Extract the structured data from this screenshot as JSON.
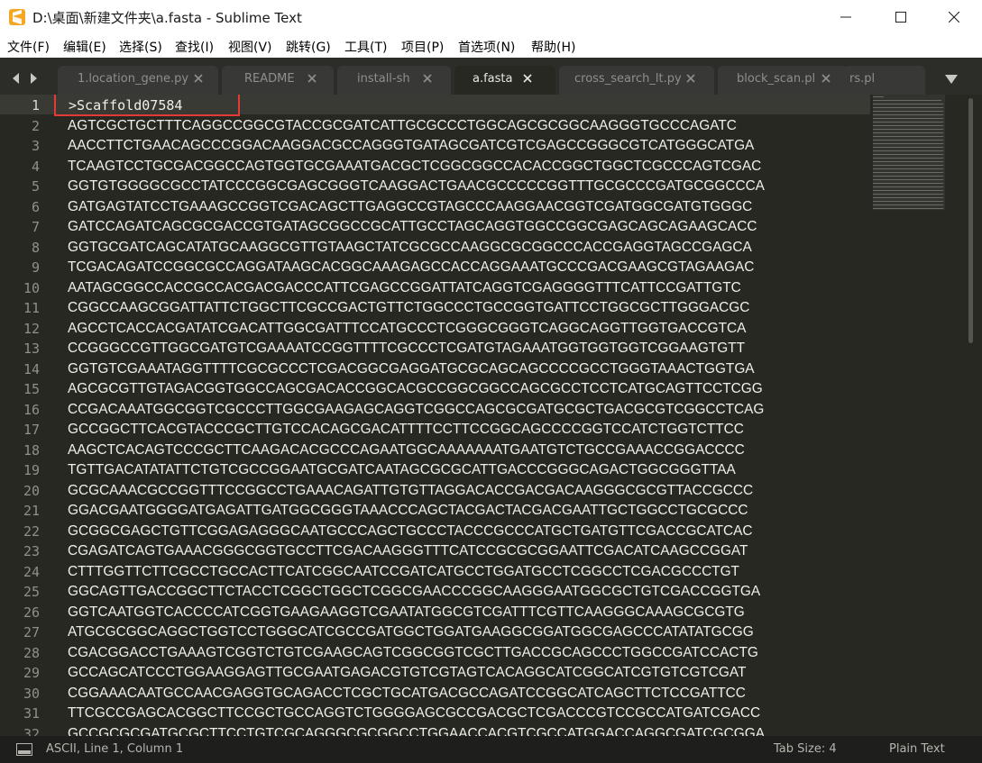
{
  "window": {
    "title": "D:\\桌面\\新建文件夹\\a.fasta - Sublime Text",
    "icon": "sublime-text-logo-icon"
  },
  "menu": [
    "文件(F)",
    "编辑(E)",
    "选择(S)",
    "查找(I)",
    "视图(V)",
    "跳转(G)",
    "工具(T)",
    "项目(P)",
    "首选项(N)",
    "帮助(H)"
  ],
  "tabs": [
    {
      "label": "1.location_gene.py",
      "active": false
    },
    {
      "label": "README",
      "active": false
    },
    {
      "label": "install-sh",
      "active": false
    },
    {
      "label": "a.fasta",
      "active": true
    },
    {
      "label": "cross_search_lt.py",
      "active": false
    },
    {
      "label": "block_scan.pl",
      "active": false
    },
    {
      "label": "rs.pl",
      "active": false
    }
  ],
  "editor": {
    "current_line": 1,
    "highlight_color": "#e53935",
    "lines": [
      ">Scaffold07584",
      "AGTCGCTGCTTTCAGGCCGGCGTACCGCGATCATTGCGCCCTGGCAGCGCGGCAAGGGTGCCCAGATC",
      "AACCTTCTGAACAGCCCGGACAAGGACGCCAGGGTGATAGCGATCGTCGAGCCGGGCGTCATGGGCATGA",
      "TCAAGTCCTGCGACGGCCAGTGGTGCGAAATGACGCTCGGCGGCCACACCGGCTGGCTCGCCCAGTCGAC",
      "GGTGTGGGGCGCCTATCCCGGCGAGCGGGTCAAGGACTGAACGCCCCCGGTTTGCGCCCGATGCGGCCCA",
      "GATGAGTATCCTGAAAGCCGGTCGACAGCTTGAGGCCGTAGCCCAAGGAACGGTCGATGGCGATGTGGGC",
      "GATCCAGATCAGCGCGACCGTGATAGCGGCCGCATTGCCTAGCAGGTGGCCGGCGAGCAGCAGAAGCACC",
      "GGTGCGATCAGCATATGCAAGGCGTTGTAAGCTATCGCGCCAAGGCGCGGCCCACCGAGGTAGCCGAGCA",
      "TCGACAGATCCGGCGCCAGGATAAGCACGGCAAAGAGCCACCAGGAAATGCCCGACGAAGCGTAGAAGAC",
      "AATAGCGGCCACCGCCACGACGACCCATTCGAGCCGGATTATCAGGTCGAGGGGTTTCATTCCGATTGTC",
      "CGGCCAAGCGGATTATTCTGGCTTCGCCGACTGTTCTGGCCCTGCCGGTGATTCCTGGCGCTTGGGACGC",
      "AGCCTCACCACGATATCGACATTGGCGATTTCCATGCCCTCGGGCGGGTCAGGCAGGTTGGTGACCGTCA",
      "CCGGGCCGTTGGCGATGTCGAAAATCCGGTTTTCGCCCTCGATGTAGAAATGGTGGTGGTCGGAAGTGTT",
      "GGTGTCGAAATAGGTTTTCGCGCCCTCGACGGCGAGGATGCGCAGCAGCCCCGCCTGGGTAAACTGGTGA",
      "AGCGCGTTGTAGACGGTGGCCAGCGACACCGGCACGCCGGCGGCCAGCGCCTCCTCATGCAGTTCCTCGG",
      "CCGACAAATGGCGGTCGCCCTTGGCGAAGAGCAGGTCGGCCAGCGCGATGCGCTGACGCGTCGGCCTCAG",
      "GCCGGCTTCACGTACCCGCTTGTCCACAGCGACATTTTCCTTCCGGCAGCCCCGGTCCATCTGGTCTTCC",
      "AAGCTCACAGTCCCGCTTCAAGACACGCCCAGAATGGCAAAAAAATGAATGTCTGCCGAAACCGGACCCC",
      "TGTTGACATATATTCTGTCGCCGGAATGCGATCAATAGCGCGCATTGACCCGGGCAGACTGGCGGGTTAA",
      "GCGCAAACGCCGGTTTCCGGCCTGAAACAGATTGTGTTAGGACACCGACGACAAGGGCGCGTTACCGCCC",
      "GGACGAATGGGGATGAGATTGATGGCGGGTAAACCCAGCTACGACTACGACGAATTGCTGGCCTGCGCCC",
      "GCGGCGAGCTGTTCGGAGAGGGCAATGCCCAGCTGCCCTACCCGCCCATGCTGATGTTCGACCGCATCAC",
      "CGAGATCAGTGAAACGGGCGGTGCCTTCGACAAGGGTTTCATCCGCGCGGAATTCGACATCAAGCCGGAT",
      "CTTTGGTTCTTCGCCTGCCACTTCATCGGCAATCCGATCATGCCTGGATGCCTCGGCCTCGACGCCCTGT",
      "GGCAGTTGACCGGCTTCTACCTCGGCTGGCTCGGCGAACCCGGCAAGGGAATGGCGCTGTCGACCGGTGA",
      "GGTCAATGGTCACCCCATCGGTGAAGAAGGTCGAATATGGCGTCGATTTCGTTCAAGGGCAAAGCGCGTG",
      "ATGCGCGGCAGGCTGGTCCTGGGCATCGCCGATGGCTGGATGAAGGCGGATGGCGAGCCCATATATGCGG",
      "CGACGGACCTGAAAGTCGGTCTGTCGAAGCAGTCGGCGGTCGCTTGACCGCAGCCCTGGCCGATCCACTG",
      "GCCAGCATCCCTGGAAGGAGTTGCGAATGAGACGTGTCGTAGTCACAGGCATCGGCATCGTGTCGTCGAT",
      "CGGAAACAATGCCAACGAGGTGCAGACCTCGCTGCATGACGCCAGATCCGGCATCAGCTTCTCCGATTCC",
      "TTCGCCGAGCACGGCTTCCGCTGCCAGGTCTGGGGAGCGCCGACGCTCGACCCGTCCGCCATGATCGACC",
      "GCCGCGCGATGCGCTTCCTGTCGCAGGGCGCGGCCTGGAACCACGTCGCCATGGACCAGGCGATCGCGGA"
    ]
  },
  "status": {
    "position": "ASCII, Line 1, Column 1",
    "tab_size": "Tab Size: 4",
    "syntax": "Plain Text"
  }
}
